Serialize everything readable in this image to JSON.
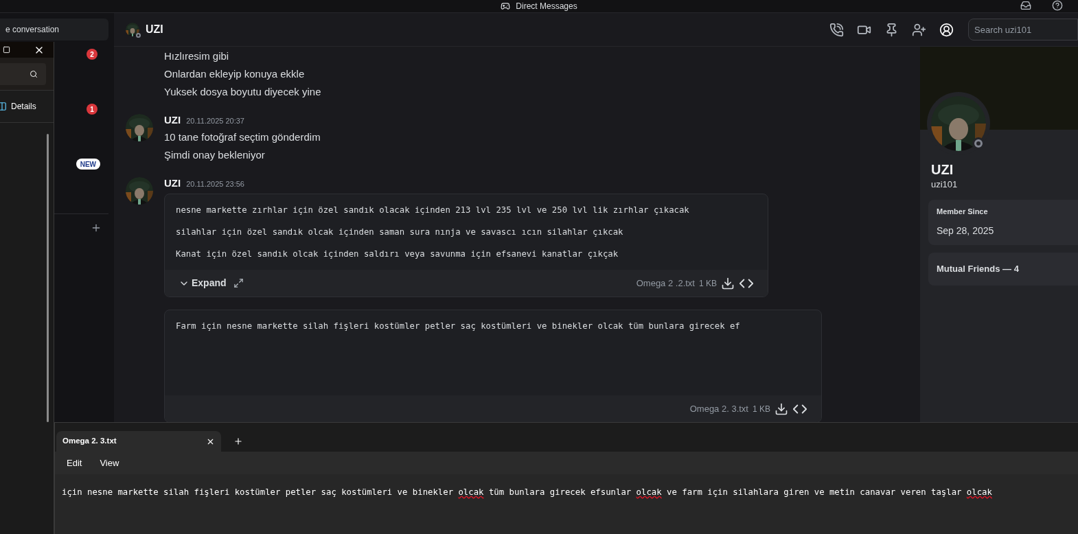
{
  "titlebar": {
    "title": "Direct Messages"
  },
  "sidebar": {
    "search_label": "e conversation",
    "badges": [
      {
        "kind": "count",
        "text": "2"
      },
      {
        "kind": "count",
        "text": "1"
      },
      {
        "kind": "new",
        "text": "NEW"
      }
    ]
  },
  "chat": {
    "name": "UZI",
    "search_placeholder": "Search uzi101",
    "messages": [
      {
        "kind": "continuation",
        "lines": [
          "Hızlıresim gibi",
          "Onlardan ekleyip konuya ekkle",
          "Yuksek dosya boyutu diyecek yine"
        ]
      },
      {
        "kind": "message",
        "author": "UZI",
        "time": "20.11.2025 20:37",
        "lines": [
          "10 tane fotoğraf seçtim gönderdim",
          "Şimdi onay bekleniyor"
        ]
      },
      {
        "kind": "message",
        "author": "UZI",
        "time": "20.11.2025 23:56",
        "attachments": [
          {
            "lines": [
              "nesne markette zırhlar için özel sandık olacak içinden 213 lvl 235 lvl ve 250 lvl lik zırhlar çıkacak",
              "silahlar için özel sandık olcak içinden saman sura nınja ve savascı ıcın silahlar çıkcak",
              "Kanat için özel sandık olcak içinden saldırı veya savunma için efsanevi kanatlar çıkçak"
            ],
            "expand_label": "Expand",
            "file_name": "Omega 2 .2.txt",
            "size": "1 KB"
          },
          {
            "lines": [
              "Farm için nesne markette silah fişleri kostümler petler saç kostümleri ve binekler olcak tüm bunlara girecek ef"
            ],
            "file_name": "Omega 2. 3.txt",
            "size": "1 KB"
          }
        ]
      }
    ]
  },
  "profile": {
    "display_name": "UZI",
    "username": "uzi101",
    "member_since_label": "Member Since",
    "member_since": "Sep 28, 2025",
    "mutual_friends": "Mutual Friends — 4"
  },
  "explorer": {
    "details_label": "Details"
  },
  "notepad": {
    "tabs": [
      {
        "label": "Omega 2. 3.txt",
        "selected": true
      }
    ],
    "menu": [
      "Edit",
      "View"
    ],
    "segments": [
      {
        "text": "için nesne markette silah fişleri kostümler petler saç kostümleri ve binekler ",
        "misspelled": false
      },
      {
        "text": "olcak",
        "misspelled": true
      },
      {
        "text": " tüm bunlara girecek efsunlar ",
        "misspelled": false
      },
      {
        "text": "olcak",
        "misspelled": true
      },
      {
        "text": " ve farm için silahlara giren ve metin canavar veren taşlar ",
        "misspelled": false
      },
      {
        "text": "olcak",
        "misspelled": true
      }
    ]
  }
}
